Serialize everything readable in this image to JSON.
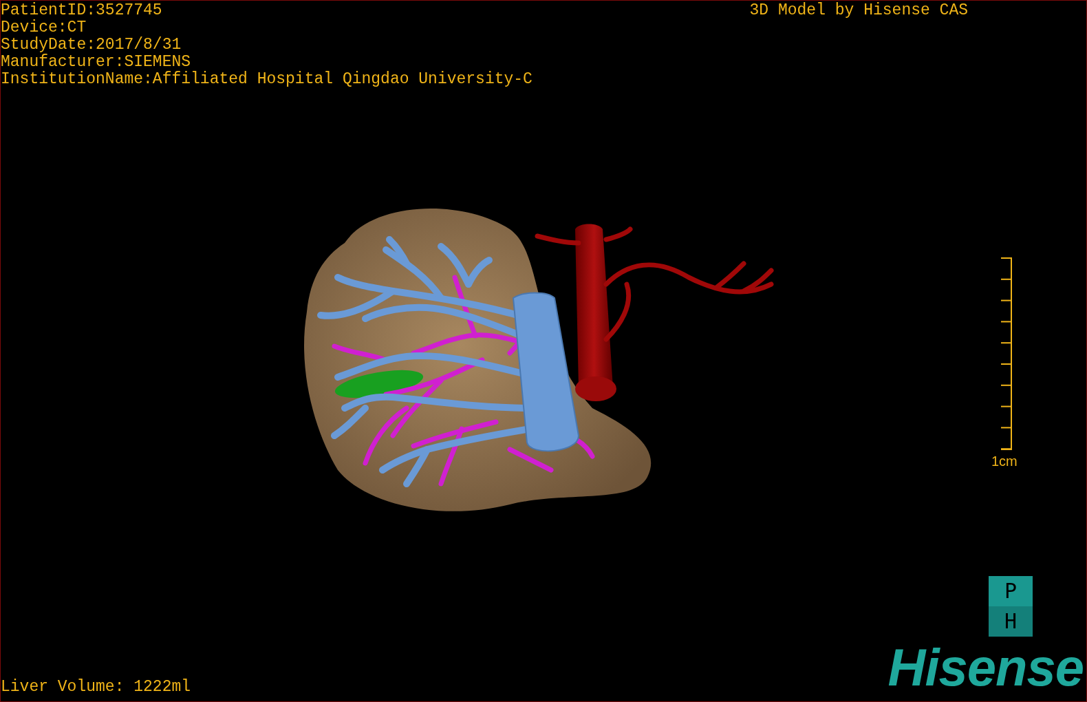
{
  "info_lines": [
    "PatientID:3527745",
    "Device:CT",
    "StudyDate:2017/8/31",
    "Manufacturer:SIEMENS",
    "InstitutionName:Affiliated Hospital Qingdao University-C"
  ],
  "title": "3D Model by Hisense CAS",
  "scale_bar": {
    "label": "1cm"
  },
  "orientation_cube": {
    "top": "P",
    "bottom": "H"
  },
  "liver_volume": "Liver Volume: 1222ml",
  "logo": {
    "text": "Hisense"
  }
}
